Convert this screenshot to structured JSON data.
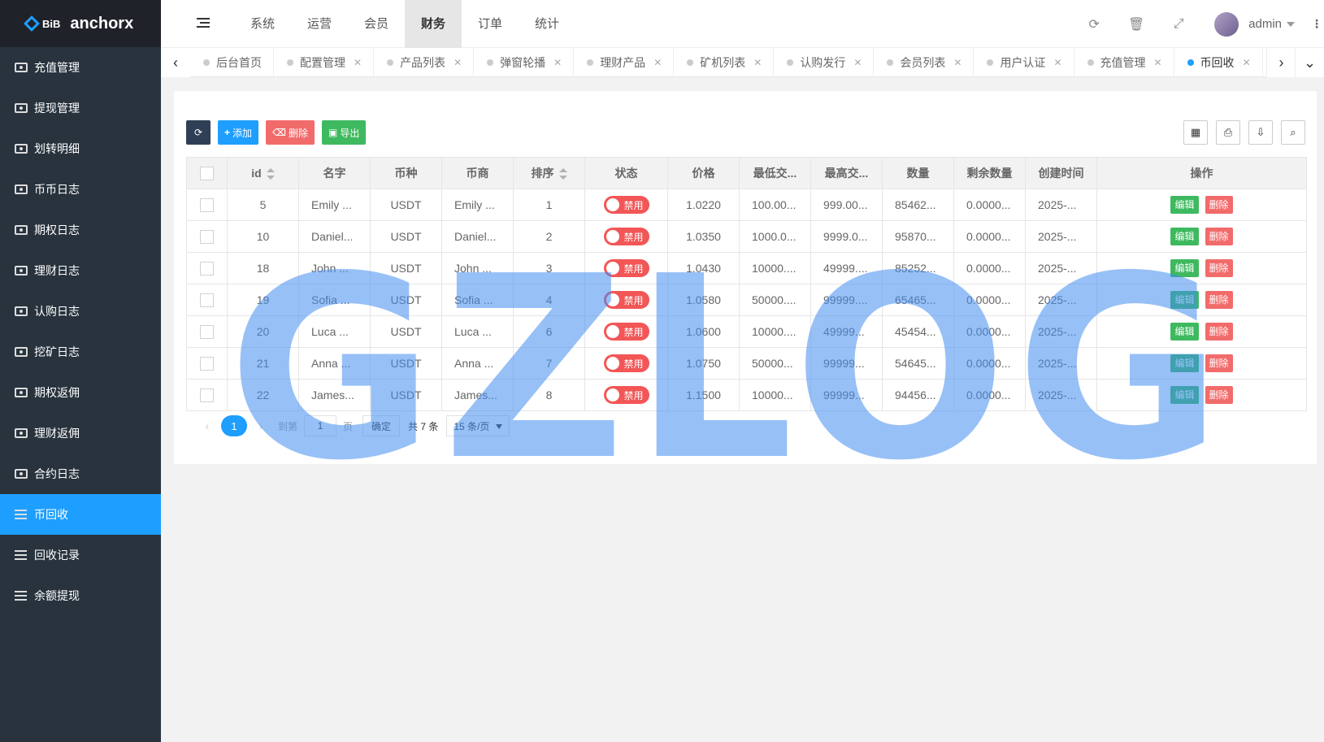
{
  "logo": {
    "mark": "BiB",
    "name": "anchorx"
  },
  "sidebar": {
    "items": [
      {
        "label": "充值管理",
        "icon": "money-icon",
        "active": false
      },
      {
        "label": "提现管理",
        "icon": "money-icon",
        "active": false
      },
      {
        "label": "划转明细",
        "icon": "money-icon",
        "active": false
      },
      {
        "label": "币币日志",
        "icon": "money-icon",
        "active": false
      },
      {
        "label": "期权日志",
        "icon": "money-icon",
        "active": false
      },
      {
        "label": "理财日志",
        "icon": "money-icon",
        "active": false
      },
      {
        "label": "认购日志",
        "icon": "money-icon",
        "active": false
      },
      {
        "label": "挖矿日志",
        "icon": "money-icon",
        "active": false
      },
      {
        "label": "期权返佣",
        "icon": "money-icon",
        "active": false
      },
      {
        "label": "理财返佣",
        "icon": "money-icon",
        "active": false
      },
      {
        "label": "合约日志",
        "icon": "money-icon",
        "active": false
      },
      {
        "label": "币回收",
        "icon": "list-icon",
        "active": true
      },
      {
        "label": "回收记录",
        "icon": "list-icon",
        "active": false
      },
      {
        "label": "余额提现",
        "icon": "list-icon",
        "active": false
      }
    ]
  },
  "header": {
    "nav": [
      "系统",
      "运营",
      "会员",
      "财务",
      "订单",
      "统计"
    ],
    "active_nav": "财务",
    "user": "admin"
  },
  "tabs": [
    {
      "label": "后台首页",
      "closable": false,
      "active": false
    },
    {
      "label": "配置管理",
      "closable": true,
      "active": false
    },
    {
      "label": "产品列表",
      "closable": true,
      "active": false
    },
    {
      "label": "弹窗轮播",
      "closable": true,
      "active": false
    },
    {
      "label": "理财产品",
      "closable": true,
      "active": false
    },
    {
      "label": "矿机列表",
      "closable": true,
      "active": false
    },
    {
      "label": "认购发行",
      "closable": true,
      "active": false
    },
    {
      "label": "会员列表",
      "closable": true,
      "active": false
    },
    {
      "label": "用户认证",
      "closable": true,
      "active": false
    },
    {
      "label": "充值管理",
      "closable": true,
      "active": false
    },
    {
      "label": "币回收",
      "closable": true,
      "active": true
    }
  ],
  "toolbar": {
    "add": "添加",
    "delete": "删除",
    "export": "导出"
  },
  "table": {
    "columns": [
      "id",
      "名字",
      "币种",
      "币商",
      "排序",
      "状态",
      "价格",
      "最低交...",
      "最高交...",
      "数量",
      "剩余数量",
      "创建时间",
      "操作"
    ],
    "rows": [
      {
        "id": "5",
        "name": "Emily ...",
        "coin": "USDT",
        "merchant": "Emily ...",
        "sort": "1",
        "status": "禁用",
        "price": "1.0220",
        "min": "100.00...",
        "max": "999.00...",
        "qty": "85462...",
        "remain": "0.0000...",
        "created": "2025-..."
      },
      {
        "id": "10",
        "name": "Daniel...",
        "coin": "USDT",
        "merchant": "Daniel...",
        "sort": "2",
        "status": "禁用",
        "price": "1.0350",
        "min": "1000.0...",
        "max": "9999.0...",
        "qty": "95870...",
        "remain": "0.0000...",
        "created": "2025-..."
      },
      {
        "id": "18",
        "name": "John ...",
        "coin": "USDT",
        "merchant": "John ...",
        "sort": "3",
        "status": "禁用",
        "price": "1.0430",
        "min": "10000....",
        "max": "49999....",
        "qty": "85252...",
        "remain": "0.0000...",
        "created": "2025-..."
      },
      {
        "id": "19",
        "name": "Sofia ...",
        "coin": "USDT",
        "merchant": "Sofia ...",
        "sort": "4",
        "status": "禁用",
        "price": "1.0580",
        "min": "50000....",
        "max": "99999....",
        "qty": "65465...",
        "remain": "0.0000...",
        "created": "2025-..."
      },
      {
        "id": "20",
        "name": "Luca ...",
        "coin": "USDT",
        "merchant": "Luca ...",
        "sort": "6",
        "status": "禁用",
        "price": "1.0600",
        "min": "10000....",
        "max": "49999...",
        "qty": "45454...",
        "remain": "0.0000...",
        "created": "2025-..."
      },
      {
        "id": "21",
        "name": "Anna ...",
        "coin": "USDT",
        "merchant": "Anna ...",
        "sort": "7",
        "status": "禁用",
        "price": "1.0750",
        "min": "50000...",
        "max": "99999...",
        "qty": "54645...",
        "remain": "0.0000...",
        "created": "2025-..."
      },
      {
        "id": "22",
        "name": "James...",
        "coin": "USDT",
        "merchant": "James...",
        "sort": "8",
        "status": "禁用",
        "price": "1.1500",
        "min": "10000...",
        "max": "99999...",
        "qty": "94456...",
        "remain": "0.0000...",
        "created": "2025-..."
      }
    ],
    "op_edit": "编辑",
    "op_delete": "删除"
  },
  "pager": {
    "current": "1",
    "goto_label": "到第",
    "page_input": "1",
    "page_suffix": "页",
    "confirm": "确定",
    "total": "共 7 条",
    "limit": "15 条/页"
  },
  "watermark": "GZLOG"
}
